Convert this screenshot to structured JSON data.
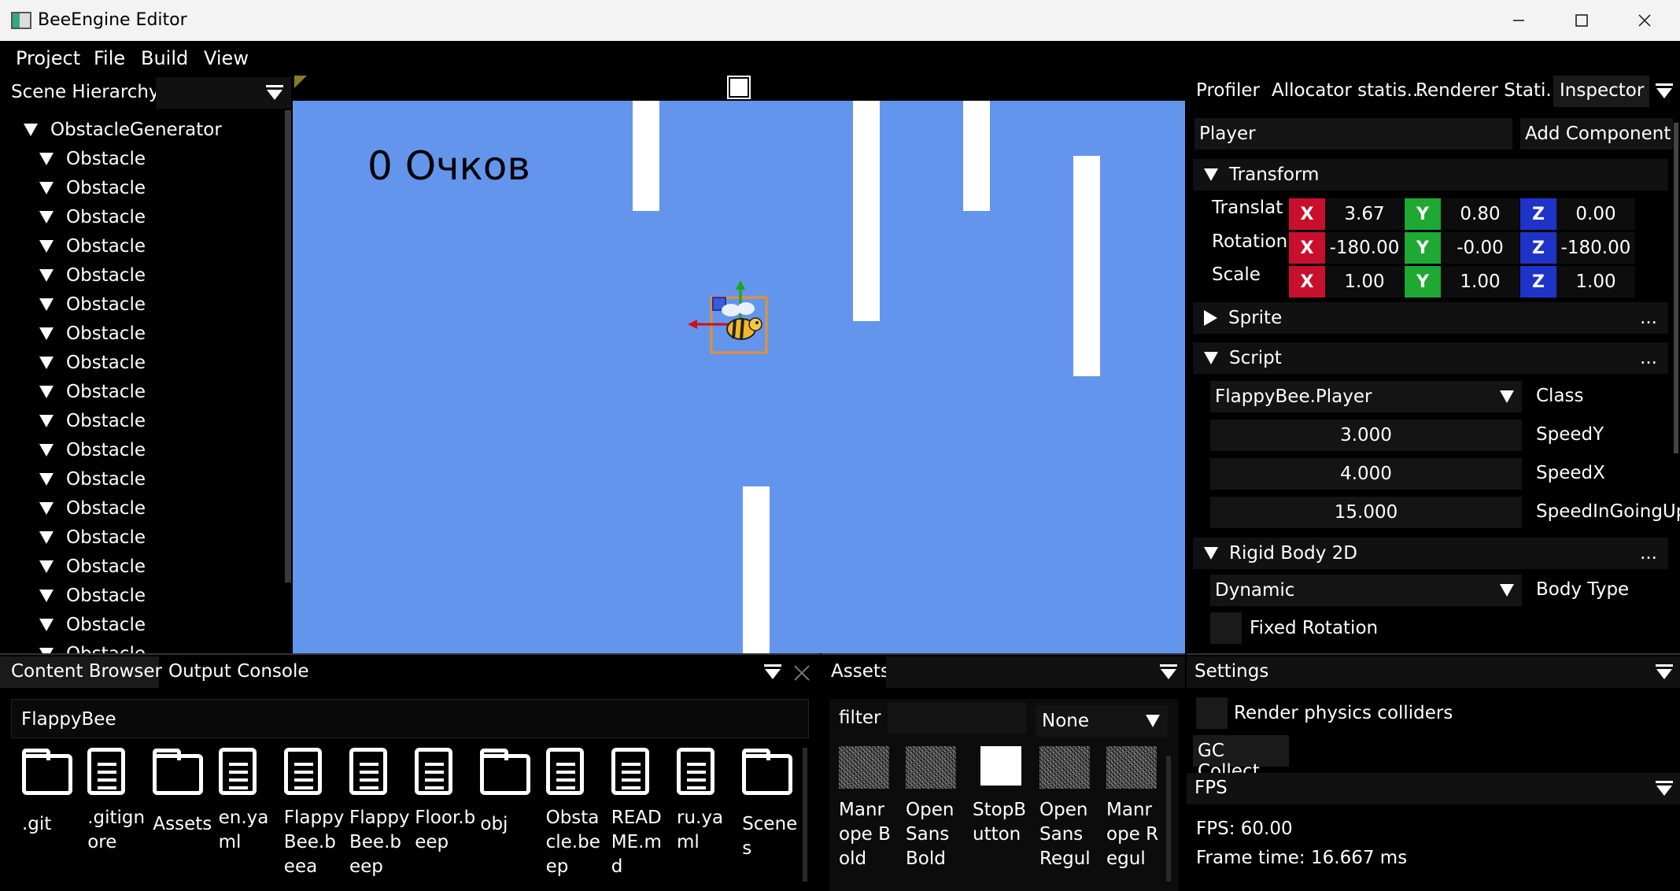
{
  "window": {
    "title": "BeeEngine Editor"
  },
  "menu": [
    "Project",
    "File",
    "Build",
    "View"
  ],
  "hierarchy": {
    "title": "Scene Hierarchy",
    "root": "ObstacleGenerator",
    "children": [
      "Obstacle",
      "Obstacle",
      "Obstacle",
      "Obstacle",
      "Obstacle",
      "Obstacle",
      "Obstacle",
      "Obstacle",
      "Obstacle",
      "Obstacle",
      "Obstacle",
      "Obstacle",
      "Obstacle",
      "Obstacle",
      "Obstacle",
      "Obstacle",
      "Obstacle",
      "Obstacle"
    ]
  },
  "viewport": {
    "score_text": "0 Очков",
    "background": "#6495ed"
  },
  "inspector": {
    "tabs": [
      "Profiler",
      "Allocator statis...",
      "Renderer Stati...",
      "Inspector"
    ],
    "entity_name": "Player",
    "add_component": "Add Component",
    "transform": {
      "title": "Transform",
      "rows": [
        {
          "label": "Translat",
          "x": "3.67",
          "y": "0.80",
          "z": "0.00"
        },
        {
          "label": "Rotation",
          "x": "-180.00",
          "y": "-0.00",
          "z": "-180.00"
        },
        {
          "label": "Scale",
          "x": "1.00",
          "y": "1.00",
          "z": "1.00"
        }
      ],
      "axes": [
        "X",
        "Y",
        "Z"
      ]
    },
    "sprite": {
      "title": "Sprite",
      "more": "..."
    },
    "script": {
      "title": "Script",
      "more": "...",
      "class_value": "FlappyBee.Player",
      "class_label": "Class",
      "fields": [
        {
          "value": "3.000",
          "label": "SpeedY"
        },
        {
          "value": "4.000",
          "label": "SpeedX"
        },
        {
          "value": "15.000",
          "label": "SpeedInGoingUp"
        }
      ]
    },
    "rigidbody": {
      "title": "Rigid Body 2D",
      "more": "...",
      "body_type_value": "Dynamic",
      "body_type_label": "Body Type",
      "fixed_rotation": "Fixed Rotation"
    }
  },
  "content_browser": {
    "tabs": [
      "Content Browser",
      "Output Console"
    ],
    "path": "FlappyBee",
    "items": [
      {
        "icon": "folder-icon",
        "name": ".git"
      },
      {
        "icon": "file-icon",
        "name": ".gitignore"
      },
      {
        "icon": "folder-icon",
        "name": "Assets"
      },
      {
        "icon": "file-icon",
        "name": "en.yaml"
      },
      {
        "icon": "file-icon",
        "name": "FlappyBee.beea"
      },
      {
        "icon": "file-icon",
        "name": "FlappyBee.beep"
      },
      {
        "icon": "file-icon",
        "name": "Floor.beep"
      },
      {
        "icon": "folder-icon",
        "name": "obj"
      },
      {
        "icon": "file-icon",
        "name": "Obstacle.beep"
      },
      {
        "icon": "file-icon",
        "name": "README.md"
      },
      {
        "icon": "file-icon",
        "name": "ru.yaml"
      },
      {
        "icon": "folder-icon",
        "name": "Scenes"
      }
    ]
  },
  "assets": {
    "title": "Assets",
    "filter_label": "filter",
    "filter_value": "",
    "type_value": "None",
    "items": [
      {
        "thumb": "noise",
        "name": "Manrope Bold"
      },
      {
        "thumb": "noise",
        "name": "OpenSans Bold"
      },
      {
        "thumb": "white",
        "name": "StopButton"
      },
      {
        "thumb": "noise",
        "name": "OpenSans Regul"
      },
      {
        "thumb": "noise",
        "name": "Manrope Regul"
      }
    ]
  },
  "settings": {
    "title": "Settings",
    "render_colliders": "Render physics colliders",
    "gc_collect": "GC Collect"
  },
  "fps": {
    "title": "FPS",
    "fps_text": "FPS: 60.00",
    "frame_time": "Frame time: 16.667 ms"
  }
}
